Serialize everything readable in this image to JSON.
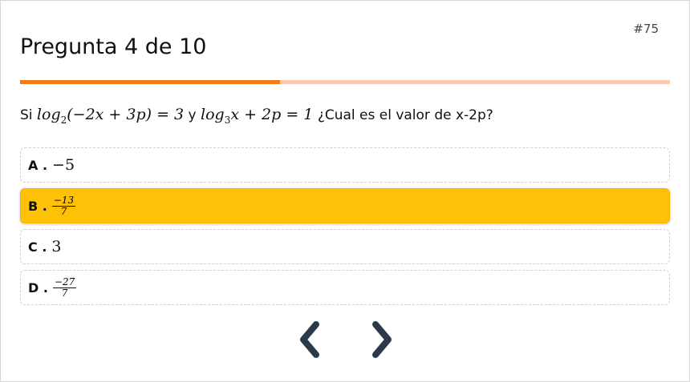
{
  "question_number": "#75",
  "title": "Pregunta 4 de 10",
  "progress": 0.4,
  "colors": {
    "progress_fill": "#ef7b1b",
    "progress_track": "#f6cdb2",
    "selected": "#ffc107",
    "nav": "#2b3a4a"
  },
  "question": {
    "prefix": "Si",
    "expr1_log": "log",
    "expr1_base": "2",
    "expr1_body": "(−2x + 3p) = 3",
    "connector": "y",
    "expr2_log": "log",
    "expr2_base": "3",
    "expr2_body": "x + 2p = 1",
    "suffix": "¿Cual es el valor de x-2p?"
  },
  "options": [
    {
      "letter": "A .",
      "value": "−5"
    },
    {
      "letter": "B .",
      "numerator": "−13",
      "denominator": "7",
      "selected": true
    },
    {
      "letter": "C .",
      "value": "3"
    },
    {
      "letter": "D .",
      "numerator": "−27",
      "denominator": "7"
    }
  ],
  "nav": {
    "prev_icon": "chevron-left-icon",
    "next_icon": "chevron-right-icon"
  }
}
